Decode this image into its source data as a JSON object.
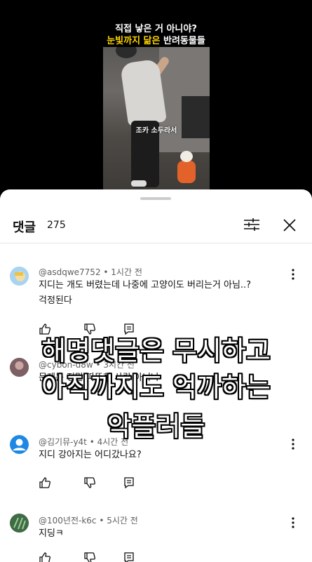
{
  "video": {
    "title_line1": "직접 낳은 거 아니야?",
    "title_line2_highlight": "눈빛까지 닮은",
    "title_line2_rest": " 반려동물들",
    "caption": "조카 소두라서"
  },
  "comments_sheet": {
    "title": "댓글",
    "count": "275",
    "filter_icon": "sliders-icon",
    "close_icon": "close-icon"
  },
  "comments": [
    {
      "author": "@asdqwe7752",
      "time": "1시간 전",
      "text_line1": "지디는 개도 버렸는데 나중에 고양이도 버리는거 아님..?",
      "text_line2": "걱정된다"
    },
    {
      "author": "@cybon-d8w",
      "time": "3시간 전",
      "text_line1": "문제는 정말 따뜻한 사람 아니냐"
    },
    {
      "author": "@김기뮤-y4t",
      "time": "4시간 전",
      "text_line1": "지디 강아지는 어디갔나요?"
    },
    {
      "author": "@100년전-k6c",
      "time": "5시간 전",
      "text_line1": "지딩ㅋ"
    }
  ],
  "overlay_caption": {
    "line1": "해명댓글은 무시하고",
    "line2": "아직까지도 억까하는",
    "line3": "악플러들"
  },
  "colors": {
    "title_highlight": "#ffd400",
    "sheet_bg": "#ffffff",
    "meta_text": "#606060"
  }
}
